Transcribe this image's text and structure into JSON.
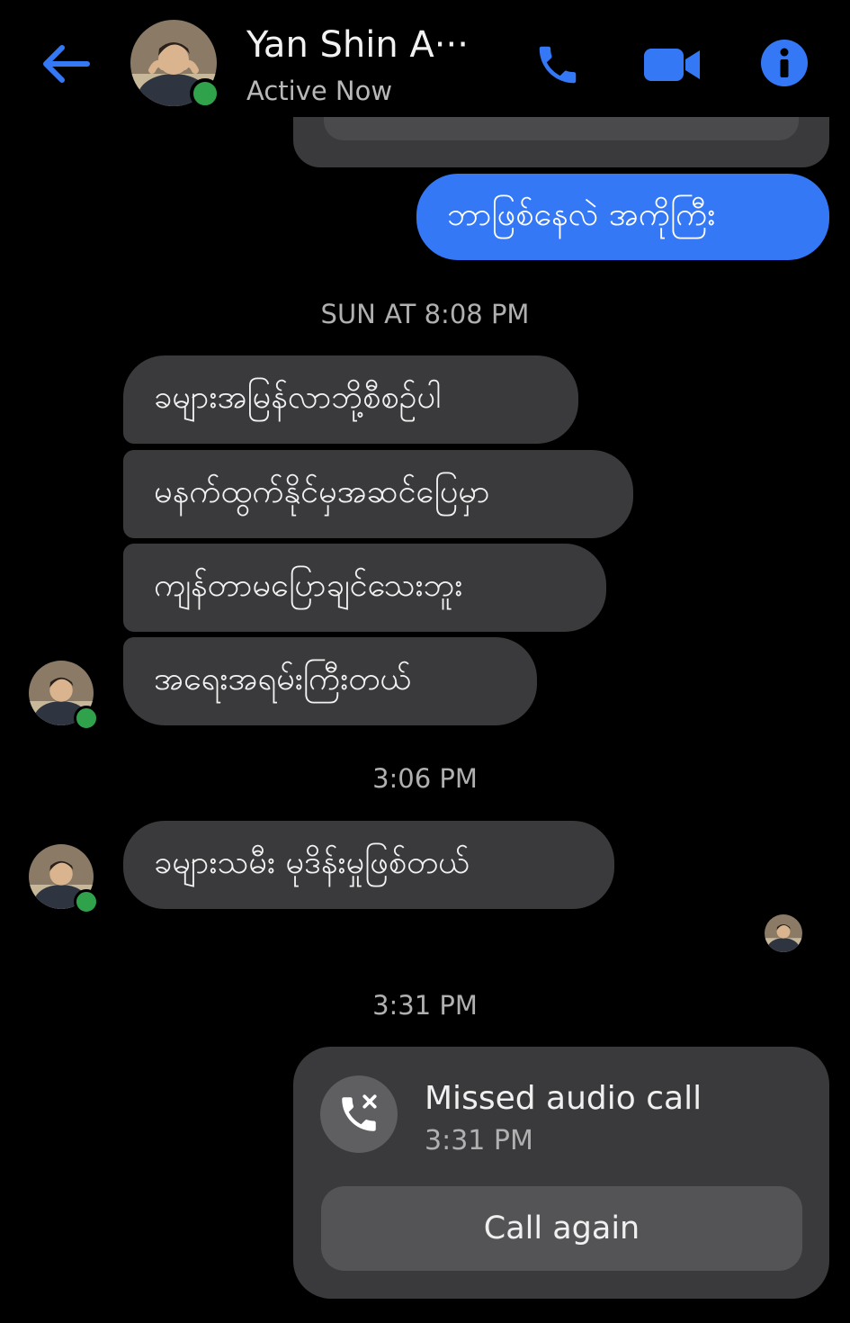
{
  "header": {
    "contact_name": "Yan Shin A···",
    "status": "Active Now"
  },
  "messages": {
    "outgoing_1": "ဘာဖြစ်နေလဲ အကိုကြီး",
    "timestamp_1": "SUN AT 8:08 PM",
    "incoming_group": [
      "ခများအမြန်လာဘို့စီစဉ်ပါ",
      "မနက်ထွက်နိုင်မှအဆင်ပြေမှာ",
      "ကျန်တာမပြောချင်သေးဘူး",
      "အရေးအရမ်းကြီးတယ်"
    ],
    "timestamp_2": "3:06 PM",
    "incoming_single": "ခများသမီး မုဒိန်းမှုဖြစ်တယ်",
    "timestamp_3": "3:31 PM"
  },
  "missed_call": {
    "title": "Missed audio call",
    "time": "3:31 PM",
    "action": "Call again"
  },
  "colors": {
    "accent": "#3478f6",
    "bubble_incoming": "#3a3a3c",
    "online": "#31a24c",
    "background": "#000000"
  }
}
